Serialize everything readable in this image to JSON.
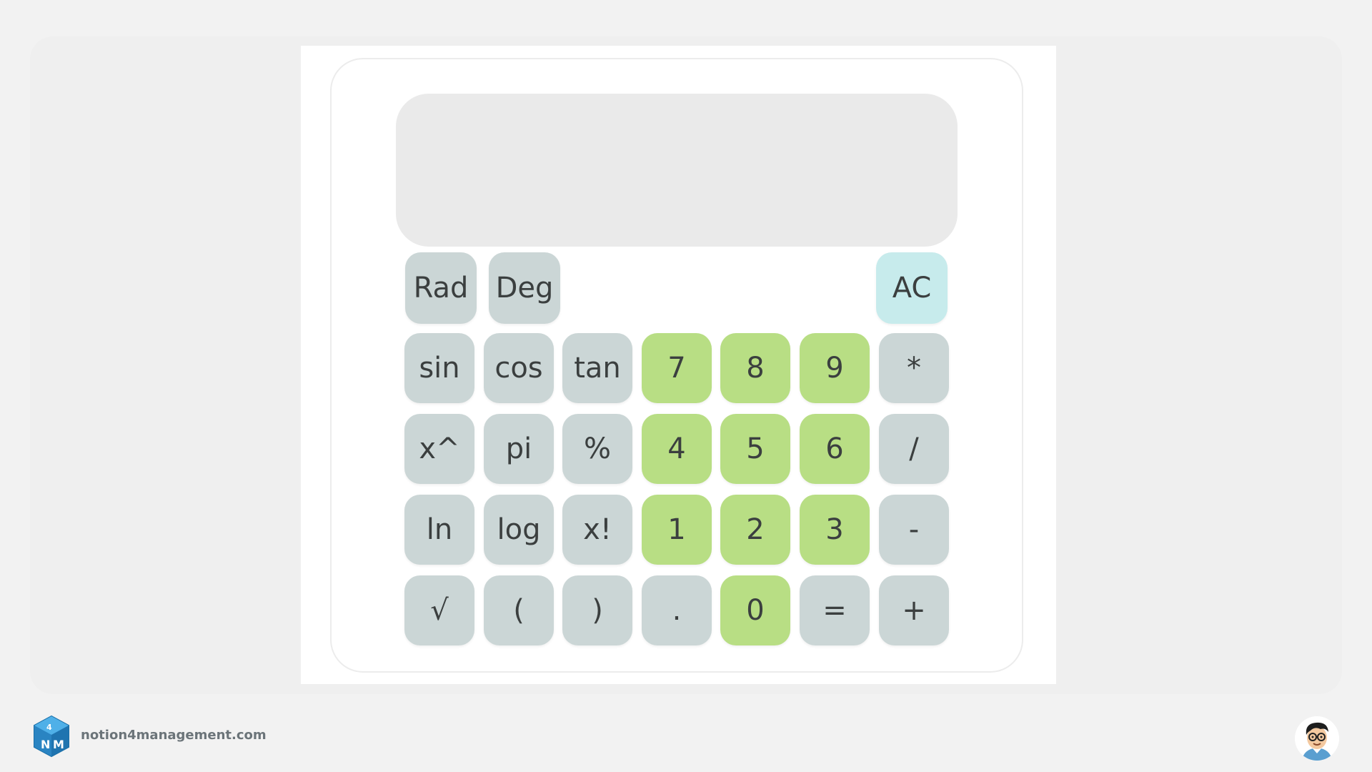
{
  "calculator": {
    "display_value": "",
    "keys": {
      "rad": "Rad",
      "deg": "Deg",
      "ac": "AC",
      "sin": "sin",
      "cos": "cos",
      "tan": "tan",
      "seven": "7",
      "eight": "8",
      "nine": "9",
      "multiply": "*",
      "power": "x^",
      "pi": "pi",
      "percent": "%",
      "four": "4",
      "five": "5",
      "six": "6",
      "divide": "/",
      "ln": "ln",
      "log": "log",
      "factorial": "x!",
      "one": "1",
      "two": "2",
      "three": "3",
      "subtract": "-",
      "sqrt": "√",
      "open_paren": "(",
      "close_paren": ")",
      "decimal": ".",
      "zero": "0",
      "equals": "=",
      "add": "+"
    }
  },
  "footer": {
    "website": "notion4management.com",
    "logo_icon": "cube-logo-icon",
    "avatar_icon": "cartoon-avatar-icon"
  },
  "colors": {
    "function_key": "#cbd6d6",
    "number_key": "#b8de84",
    "clear_key": "#c7ebec",
    "display": "#eaeaea"
  }
}
